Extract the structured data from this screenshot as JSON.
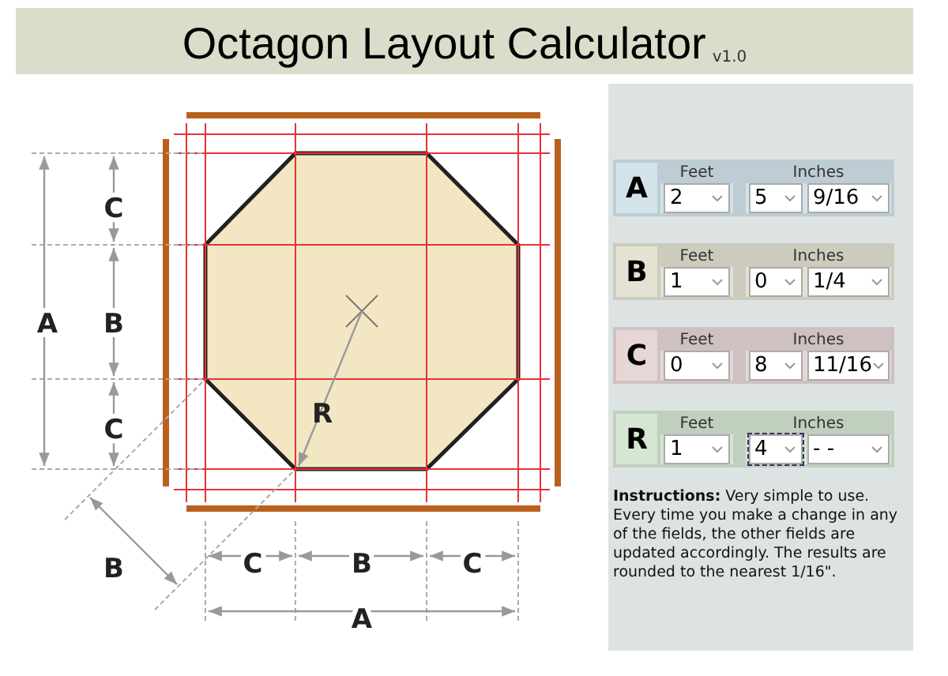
{
  "title": "Octagon Layout Calculator",
  "version": "v1.0",
  "diagram": {
    "labels": [
      "C",
      "B",
      "C",
      "A",
      "R",
      "B",
      "C",
      "B",
      "C",
      "A"
    ]
  },
  "rows": [
    {
      "letter": "A",
      "color": "#d3e3ea",
      "feet_label": "Feet",
      "inches_label": "Inches",
      "feet": "2",
      "inches": "5",
      "fraction": "9/16",
      "inches_focused": false
    },
    {
      "letter": "B",
      "color": "#e4e2d2",
      "feet_label": "Feet",
      "inches_label": "Inches",
      "feet": "1",
      "inches": "0",
      "fraction": "1/4",
      "inches_focused": false
    },
    {
      "letter": "C",
      "color": "#e6d6d6",
      "feet_label": "Feet",
      "inches_label": "Inches",
      "feet": "0",
      "inches": "8",
      "fraction": "11/16",
      "inches_focused": false
    },
    {
      "letter": "R",
      "color": "#d5e6d3",
      "feet_label": "Feet",
      "inches_label": "Inches",
      "feet": "1",
      "inches": "4",
      "fraction": "- -",
      "inches_focused": true
    }
  ],
  "instructions": "**Instructions:** Very simple to use. Every time you make a change in any of the fields, the other fields are updated accordingly. The results are rounded to the nearest 1/16\"."
}
